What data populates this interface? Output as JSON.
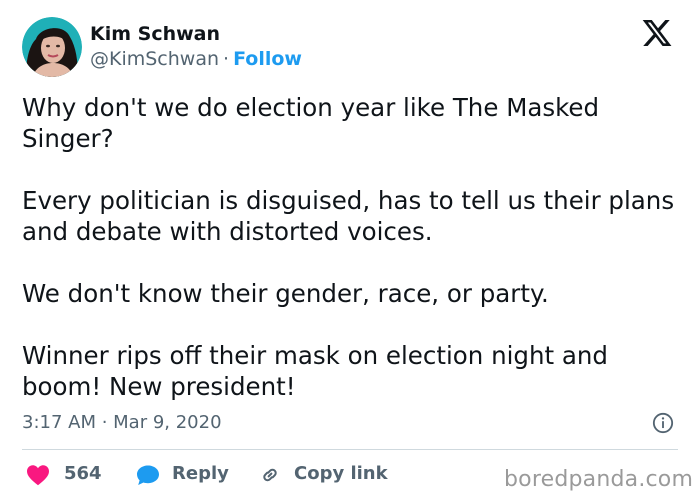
{
  "author": {
    "name": "Kim Schwan",
    "handle": "@KimSchwan",
    "separator": "·",
    "follow_label": "Follow"
  },
  "tweet": {
    "text": "Why don't we do election year like The Masked Singer?\n\nEvery politician is disguised, has to tell us their plans and debate with distorted voices.\n\nWe don't know their gender, race, or party.\n\nWinner rips off their mask on election night and boom! New president!",
    "timestamp": "3:17 AM · Mar 9, 2020"
  },
  "actions": {
    "like_count": "564",
    "reply_label": "Reply",
    "copy_label": "Copy link"
  },
  "watermark": "boredpanda.com",
  "icons": {
    "brand": "x-logo-icon",
    "info": "info-icon",
    "like": "heart-icon",
    "reply": "speech-bubble-icon",
    "copy": "link-icon"
  },
  "colors": {
    "accent": "#1d9bf0",
    "like": "#f91880",
    "text": "#0f1419",
    "muted": "#536471"
  }
}
